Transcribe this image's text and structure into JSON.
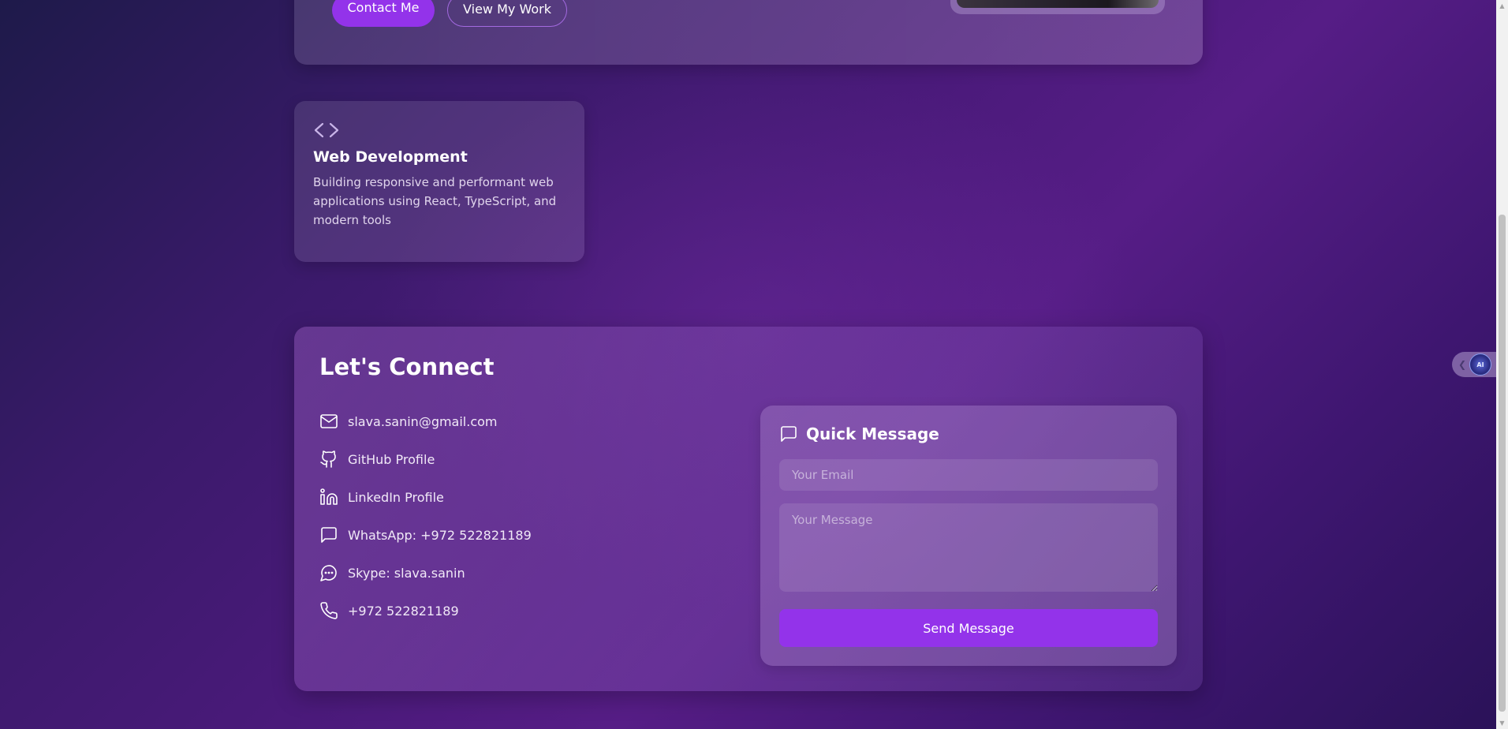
{
  "hero": {
    "contact_button": "Contact Me",
    "work_button": "View My Work"
  },
  "service": {
    "icon": "code-icon",
    "title": "Web Development",
    "description": "Building responsive and performant web applications using React, TypeScript, and modern tools"
  },
  "connect": {
    "title": "Let's Connect",
    "contacts": [
      {
        "icon": "mail-icon",
        "label": "slava.sanin@gmail.com"
      },
      {
        "icon": "github-icon",
        "label": "GitHub Profile"
      },
      {
        "icon": "linkedin-icon",
        "label": "LinkedIn Profile"
      },
      {
        "icon": "message-square-icon",
        "label": "WhatsApp: +972 522821189"
      },
      {
        "icon": "message-circle-icon",
        "label": "Skype: slava.sanin"
      },
      {
        "icon": "phone-icon",
        "label": "+972 522821189"
      }
    ],
    "quick_message": {
      "icon": "message-square-icon",
      "title": "Quick Message",
      "email_placeholder": "Your Email",
      "email_value": "",
      "message_placeholder": "Your Message",
      "message_value": "",
      "send_label": "Send Message"
    }
  },
  "ai_widget": {
    "chevron_icon": "chevron-left-icon",
    "avatar_label": "AI"
  },
  "colors": {
    "accent": "#9333ea",
    "background_start": "#1e1a4a",
    "background_mid": "#561d86",
    "text_muted": "#e0d4ec"
  }
}
